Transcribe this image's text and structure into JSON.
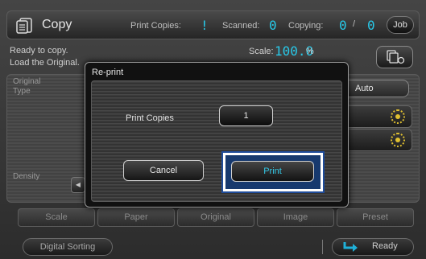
{
  "header": {
    "title": "Copy",
    "print_copies_label": "Print Copies:",
    "print_copies_value": "!",
    "scanned_label": "Scanned:",
    "scanned_value": "0",
    "copying_label": "Copying:",
    "copying_value": "0",
    "copying_separator": "/",
    "copying_total": "0",
    "job_button": "Job",
    "icon": "copy-icon"
  },
  "status": {
    "line1": "Ready to copy.",
    "line2": "Load the Original.",
    "scale_label": "Scale:",
    "scale_value": "100.0",
    "scale_unit": "%",
    "copy_mode_icon": "copy-mode-icon"
  },
  "panel": {
    "original_type_label": "Original Type",
    "density_label": "Density",
    "density_left_icon": "arrow-left-icon",
    "auto_label": "Auto",
    "gear_icon": "gear-icon"
  },
  "tabs": [
    "Scale",
    "Paper",
    "Original",
    "Image",
    "Preset"
  ],
  "footer": {
    "digital_sorting": "Digital Sorting",
    "ready": "Ready",
    "ready_icon": "return-arrow-icon"
  },
  "dialog": {
    "title": "Re-print",
    "print_copies_label": "Print Copies",
    "print_copies_value": "1",
    "cancel": "Cancel",
    "print": "Print"
  },
  "colors": {
    "accent_lcd": "#28c8e8",
    "gear": "#e0c030",
    "focus_outline": "#1f4c9a"
  }
}
